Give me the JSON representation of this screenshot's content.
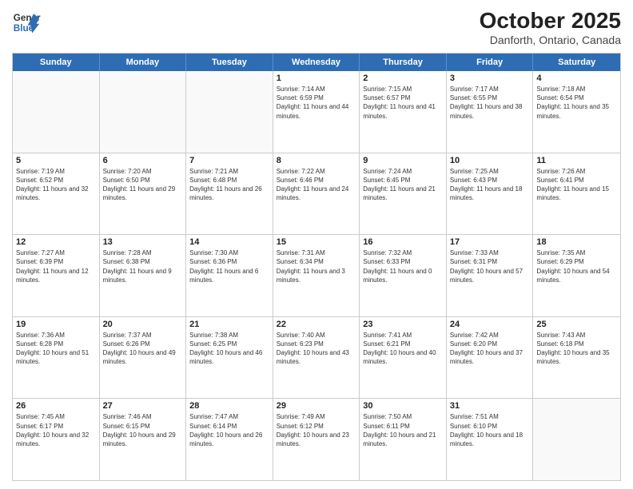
{
  "header": {
    "logo": {
      "line1": "General",
      "line2": "Blue"
    },
    "title": "October 2025",
    "subtitle": "Danforth, Ontario, Canada"
  },
  "days_of_week": [
    "Sunday",
    "Monday",
    "Tuesday",
    "Wednesday",
    "Thursday",
    "Friday",
    "Saturday"
  ],
  "weeks": [
    [
      {
        "day": "",
        "empty": true
      },
      {
        "day": "",
        "empty": true
      },
      {
        "day": "",
        "empty": true
      },
      {
        "day": "1",
        "sunrise": "7:14 AM",
        "sunset": "6:59 PM",
        "daylight": "11 hours and 44 minutes."
      },
      {
        "day": "2",
        "sunrise": "7:15 AM",
        "sunset": "6:57 PM",
        "daylight": "11 hours and 41 minutes."
      },
      {
        "day": "3",
        "sunrise": "7:17 AM",
        "sunset": "6:55 PM",
        "daylight": "11 hours and 38 minutes."
      },
      {
        "day": "4",
        "sunrise": "7:18 AM",
        "sunset": "6:54 PM",
        "daylight": "11 hours and 35 minutes."
      }
    ],
    [
      {
        "day": "5",
        "sunrise": "7:19 AM",
        "sunset": "6:52 PM",
        "daylight": "11 hours and 32 minutes."
      },
      {
        "day": "6",
        "sunrise": "7:20 AM",
        "sunset": "6:50 PM",
        "daylight": "11 hours and 29 minutes."
      },
      {
        "day": "7",
        "sunrise": "7:21 AM",
        "sunset": "6:48 PM",
        "daylight": "11 hours and 26 minutes."
      },
      {
        "day": "8",
        "sunrise": "7:22 AM",
        "sunset": "6:46 PM",
        "daylight": "11 hours and 24 minutes."
      },
      {
        "day": "9",
        "sunrise": "7:24 AM",
        "sunset": "6:45 PM",
        "daylight": "11 hours and 21 minutes."
      },
      {
        "day": "10",
        "sunrise": "7:25 AM",
        "sunset": "6:43 PM",
        "daylight": "11 hours and 18 minutes."
      },
      {
        "day": "11",
        "sunrise": "7:26 AM",
        "sunset": "6:41 PM",
        "daylight": "11 hours and 15 minutes."
      }
    ],
    [
      {
        "day": "12",
        "sunrise": "7:27 AM",
        "sunset": "6:39 PM",
        "daylight": "11 hours and 12 minutes."
      },
      {
        "day": "13",
        "sunrise": "7:28 AM",
        "sunset": "6:38 PM",
        "daylight": "11 hours and 9 minutes."
      },
      {
        "day": "14",
        "sunrise": "7:30 AM",
        "sunset": "6:36 PM",
        "daylight": "11 hours and 6 minutes."
      },
      {
        "day": "15",
        "sunrise": "7:31 AM",
        "sunset": "6:34 PM",
        "daylight": "11 hours and 3 minutes."
      },
      {
        "day": "16",
        "sunrise": "7:32 AM",
        "sunset": "6:33 PM",
        "daylight": "11 hours and 0 minutes."
      },
      {
        "day": "17",
        "sunrise": "7:33 AM",
        "sunset": "6:31 PM",
        "daylight": "10 hours and 57 minutes."
      },
      {
        "day": "18",
        "sunrise": "7:35 AM",
        "sunset": "6:29 PM",
        "daylight": "10 hours and 54 minutes."
      }
    ],
    [
      {
        "day": "19",
        "sunrise": "7:36 AM",
        "sunset": "6:28 PM",
        "daylight": "10 hours and 51 minutes."
      },
      {
        "day": "20",
        "sunrise": "7:37 AM",
        "sunset": "6:26 PM",
        "daylight": "10 hours and 49 minutes."
      },
      {
        "day": "21",
        "sunrise": "7:38 AM",
        "sunset": "6:25 PM",
        "daylight": "10 hours and 46 minutes."
      },
      {
        "day": "22",
        "sunrise": "7:40 AM",
        "sunset": "6:23 PM",
        "daylight": "10 hours and 43 minutes."
      },
      {
        "day": "23",
        "sunrise": "7:41 AM",
        "sunset": "6:21 PM",
        "daylight": "10 hours and 40 minutes."
      },
      {
        "day": "24",
        "sunrise": "7:42 AM",
        "sunset": "6:20 PM",
        "daylight": "10 hours and 37 minutes."
      },
      {
        "day": "25",
        "sunrise": "7:43 AM",
        "sunset": "6:18 PM",
        "daylight": "10 hours and 35 minutes."
      }
    ],
    [
      {
        "day": "26",
        "sunrise": "7:45 AM",
        "sunset": "6:17 PM",
        "daylight": "10 hours and 32 minutes."
      },
      {
        "day": "27",
        "sunrise": "7:46 AM",
        "sunset": "6:15 PM",
        "daylight": "10 hours and 29 minutes."
      },
      {
        "day": "28",
        "sunrise": "7:47 AM",
        "sunset": "6:14 PM",
        "daylight": "10 hours and 26 minutes."
      },
      {
        "day": "29",
        "sunrise": "7:49 AM",
        "sunset": "6:12 PM",
        "daylight": "10 hours and 23 minutes."
      },
      {
        "day": "30",
        "sunrise": "7:50 AM",
        "sunset": "6:11 PM",
        "daylight": "10 hours and 21 minutes."
      },
      {
        "day": "31",
        "sunrise": "7:51 AM",
        "sunset": "6:10 PM",
        "daylight": "10 hours and 18 minutes."
      },
      {
        "day": "",
        "empty": true
      }
    ]
  ],
  "labels": {
    "sunrise": "Sunrise:",
    "sunset": "Sunset:",
    "daylight": "Daylight:"
  }
}
